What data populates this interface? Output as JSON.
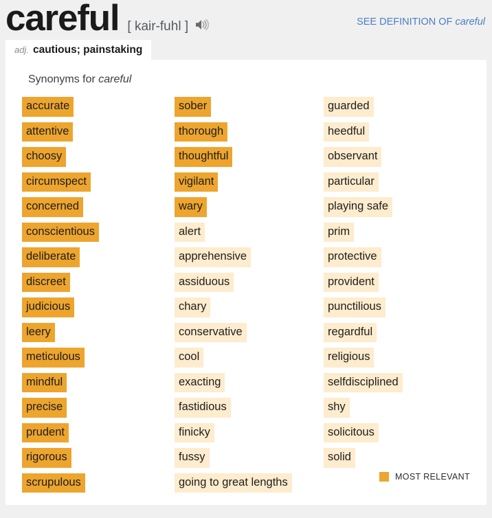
{
  "header": {
    "headword": "careful",
    "pronunciation": "[ kair-fuhl ]",
    "audio_icon": "speaker-icon",
    "see_definition_prefix": "SEE DEFINITION OF ",
    "see_definition_word": "careful",
    "link_color": "#4a7ec4"
  },
  "pos_tab": {
    "abbreviation": "adj.",
    "definition": "cautious; painstaking"
  },
  "synonyms_panel": {
    "label_prefix": "Synonyms for ",
    "label_word": "careful",
    "columns": [
      {
        "items": [
          {
            "text": "accurate",
            "tier": "high"
          },
          {
            "text": "attentive",
            "tier": "high"
          },
          {
            "text": "choosy",
            "tier": "high"
          },
          {
            "text": "circumspect",
            "tier": "high"
          },
          {
            "text": "concerned",
            "tier": "high"
          },
          {
            "text": "conscientious",
            "tier": "high"
          },
          {
            "text": "deliberate",
            "tier": "high"
          },
          {
            "text": "discreet",
            "tier": "high"
          },
          {
            "text": "judicious",
            "tier": "high"
          },
          {
            "text": "leery",
            "tier": "high"
          },
          {
            "text": "meticulous",
            "tier": "high"
          },
          {
            "text": "mindful",
            "tier": "high"
          },
          {
            "text": "precise",
            "tier": "high"
          },
          {
            "text": "prudent",
            "tier": "high"
          },
          {
            "text": "rigorous",
            "tier": "high"
          },
          {
            "text": "scrupulous",
            "tier": "high"
          }
        ]
      },
      {
        "items": [
          {
            "text": "sober",
            "tier": "high"
          },
          {
            "text": "thorough",
            "tier": "high"
          },
          {
            "text": "thoughtful",
            "tier": "high"
          },
          {
            "text": "vigilant",
            "tier": "high"
          },
          {
            "text": "wary",
            "tier": "high"
          },
          {
            "text": "alert",
            "tier": "low"
          },
          {
            "text": "apprehensive",
            "tier": "low"
          },
          {
            "text": "assiduous",
            "tier": "low"
          },
          {
            "text": "chary",
            "tier": "low"
          },
          {
            "text": "conservative",
            "tier": "low"
          },
          {
            "text": "cool",
            "tier": "low"
          },
          {
            "text": "exacting",
            "tier": "low"
          },
          {
            "text": "fastidious",
            "tier": "low"
          },
          {
            "text": "finicky",
            "tier": "low"
          },
          {
            "text": "fussy",
            "tier": "low"
          },
          {
            "text": "going to great lengths",
            "tier": "low"
          }
        ]
      },
      {
        "items": [
          {
            "text": "guarded",
            "tier": "low"
          },
          {
            "text": "heedful",
            "tier": "low"
          },
          {
            "text": "observant",
            "tier": "low"
          },
          {
            "text": "particular",
            "tier": "low"
          },
          {
            "text": "playing safe",
            "tier": "low"
          },
          {
            "text": "prim",
            "tier": "low"
          },
          {
            "text": "protective",
            "tier": "low"
          },
          {
            "text": "provident",
            "tier": "low"
          },
          {
            "text": "punctilious",
            "tier": "low"
          },
          {
            "text": "regardful",
            "tier": "low"
          },
          {
            "text": "religious",
            "tier": "low"
          },
          {
            "text": "selfdisciplined",
            "tier": "low"
          },
          {
            "text": "shy",
            "tier": "low"
          },
          {
            "text": "solicitous",
            "tier": "low"
          },
          {
            "text": "solid",
            "tier": "low"
          }
        ]
      }
    ]
  },
  "legend": {
    "label": "MOST RELEVANT",
    "swatch_color": "#eda52e"
  },
  "colors": {
    "tier_high": "#eda52e",
    "tier_low": "#fdeccd",
    "page_background": "#f0f0f0",
    "card_background": "#ffffff"
  }
}
